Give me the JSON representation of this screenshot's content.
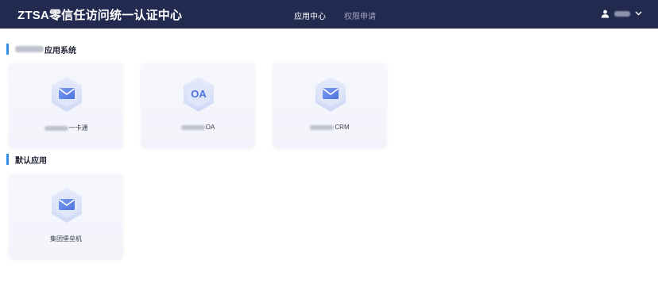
{
  "header": {
    "brand": "ZTSA零信任访问统一认证中心",
    "nav": [
      {
        "label": "应用中心",
        "active": true
      },
      {
        "label": "权限申请",
        "active": false
      }
    ],
    "user_icon": "user-icon",
    "dropdown_icon": "chevron-down-icon"
  },
  "sections": [
    {
      "title_suffix": "应用系统",
      "apps": [
        {
          "icon": "mail-icon",
          "label_suffix": "一卡通"
        },
        {
          "icon": "oa-icon",
          "icon_text": "OA",
          "label_suffix": "OA"
        },
        {
          "icon": "mail-icon",
          "label_suffix": "CRM"
        }
      ]
    },
    {
      "title": "默认应用",
      "apps": [
        {
          "icon": "mail-icon",
          "label": "集团堡垒机"
        }
      ]
    }
  ],
  "colors": {
    "header_bg": "#222a4f",
    "accent": "#2f8fe6",
    "nav_inactive": "#9ea3bd"
  }
}
